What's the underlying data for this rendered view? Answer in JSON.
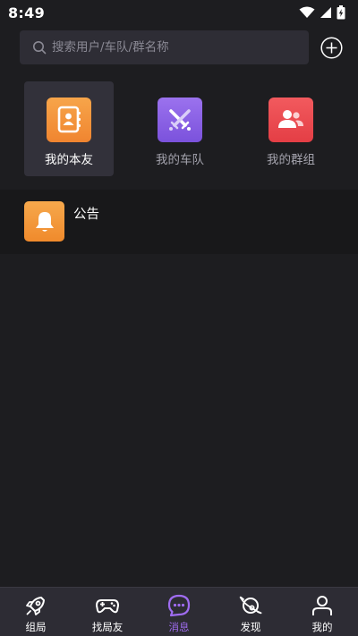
{
  "status_bar": {
    "time": "8:49"
  },
  "search": {
    "placeholder": "搜索用户/车队/群名称",
    "value": ""
  },
  "entries": [
    {
      "label": "我的本友",
      "icon": "address-book-icon",
      "color": "#f4943a",
      "selected": true
    },
    {
      "label": "我的车队",
      "icon": "crossed-swords-icon",
      "color": "#8d62e6",
      "selected": false
    },
    {
      "label": "我的群组",
      "icon": "group-icon",
      "color": "#ee4d52",
      "selected": false
    }
  ],
  "notice": {
    "title": "公告",
    "icon": "bell-icon",
    "color": "#f39a3a"
  },
  "tabs": [
    {
      "label": "组局",
      "icon": "rocket-icon",
      "active": false
    },
    {
      "label": "找局友",
      "icon": "gamepad-icon",
      "active": false
    },
    {
      "label": "消息",
      "icon": "chat-bubble-icon",
      "active": true
    },
    {
      "label": "发现",
      "icon": "planet-icon",
      "active": false
    },
    {
      "label": "我的",
      "icon": "person-icon",
      "active": false
    }
  ],
  "colors": {
    "background": "#1d1d20",
    "search_bg": "#2e2d35",
    "tab_bar_bg": "#2d2c34",
    "accent": "#9f6cf0"
  }
}
